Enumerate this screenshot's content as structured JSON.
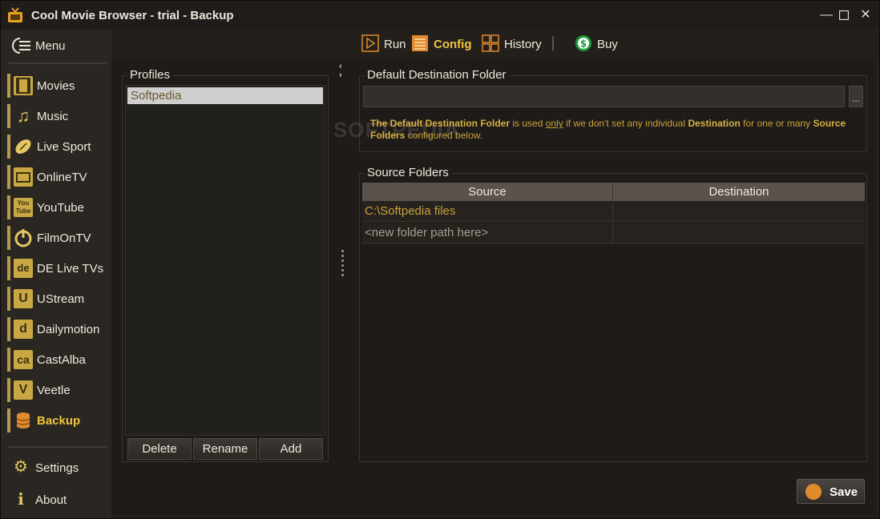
{
  "window": {
    "title": "Cool Movie Browser - trial - Backup"
  },
  "sidebar": {
    "menu_label": "Menu",
    "items": [
      {
        "label": "Movies",
        "icon": "film-icon"
      },
      {
        "label": "Music",
        "icon": "music-note-icon"
      },
      {
        "label": "Live Sport",
        "icon": "football-icon"
      },
      {
        "label": "OnlineTV",
        "icon": "tv-icon"
      },
      {
        "label": "YouTube",
        "icon": "youtube-icon"
      },
      {
        "label": "FilmOnTV",
        "icon": "power-icon"
      },
      {
        "label": "DE Live TVs",
        "icon": "de-icon",
        "glyph": "de"
      },
      {
        "label": "UStream",
        "icon": "ustream-icon",
        "glyph": "U"
      },
      {
        "label": "Dailymotion",
        "icon": "dailymotion-icon",
        "glyph": "d"
      },
      {
        "label": "CastAlba",
        "icon": "castalba-icon",
        "glyph": "ca"
      },
      {
        "label": "Veetle",
        "icon": "veetle-icon",
        "glyph": "V"
      },
      {
        "label": "Backup",
        "icon": "database-icon",
        "active": true
      }
    ],
    "settings_label": "Settings",
    "about_label": "About"
  },
  "toolbar": {
    "run_label": "Run",
    "config_label": "Config",
    "history_label": "History",
    "buy_label": "Buy"
  },
  "profiles": {
    "title": "Profiles",
    "items": [
      "Softpedia"
    ],
    "delete_label": "Delete",
    "rename_label": "Rename",
    "add_label": "Add"
  },
  "destination": {
    "title": "Default Destination Folder",
    "value": "",
    "browse_label": "...",
    "hint": {
      "p1": "The Default Destination Folder",
      "p2": " is used ",
      "p3": "only",
      "p4": " if we don't set any individual ",
      "p5": "Destination",
      "p6": " for one or many ",
      "p7": "Source",
      "p8": "Folders",
      "p9": " configured below."
    }
  },
  "source_folders": {
    "title": "Source Folders",
    "columns": [
      "Source",
      "Destination"
    ],
    "rows": [
      {
        "source": "C:\\Softpedia files",
        "destination": ""
      },
      {
        "source": "<new folder path here>",
        "destination": ""
      }
    ]
  },
  "save_label": "Save",
  "watermark": "SOFTPEDIA",
  "colors": {
    "accent": "#f0c43a",
    "icon_gold": "#c9a844",
    "background": "#1e1b18"
  }
}
